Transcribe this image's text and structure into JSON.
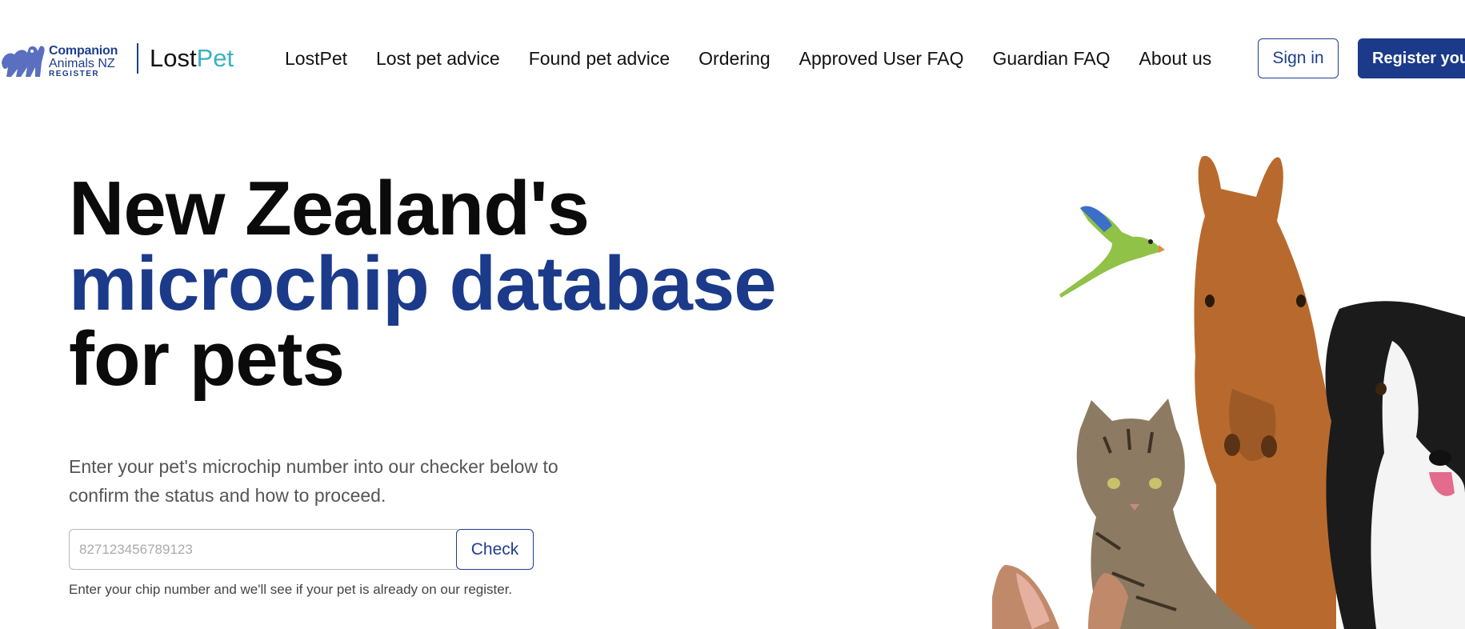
{
  "header": {
    "logo": {
      "org_line1": "Companion",
      "org_line2": "Animals NZ",
      "org_line3": "REGISTER",
      "brand_main": "Lost",
      "brand_accent": "Pet"
    },
    "nav": [
      {
        "label": "LostPet"
      },
      {
        "label": "Lost pet advice"
      },
      {
        "label": "Found pet advice"
      },
      {
        "label": "Ordering"
      },
      {
        "label": "Approved User FAQ"
      },
      {
        "label": "Guardian FAQ"
      },
      {
        "label": "About us"
      }
    ],
    "signin_label": "Sign in",
    "register_label": "Register your pet"
  },
  "hero": {
    "title_line1": "New Zealand's",
    "title_line2": "microchip database",
    "title_line3": "for pets",
    "intro": "Enter your pet's microchip number into our checker below to confirm the status and how to proceed.",
    "checker": {
      "placeholder": "827123456789123",
      "button_label": "Check"
    },
    "hint": "Enter your chip number and we'll see if your pet is already on our register."
  },
  "colors": {
    "brand_blue": "#1b3a8a",
    "accent_teal": "#3cb0c0",
    "text_dark": "#0b0b0b",
    "text_muted": "#555555"
  },
  "icons": {
    "logo_mark": "pets-silhouette-icon",
    "illustration": "animals-group-image"
  }
}
